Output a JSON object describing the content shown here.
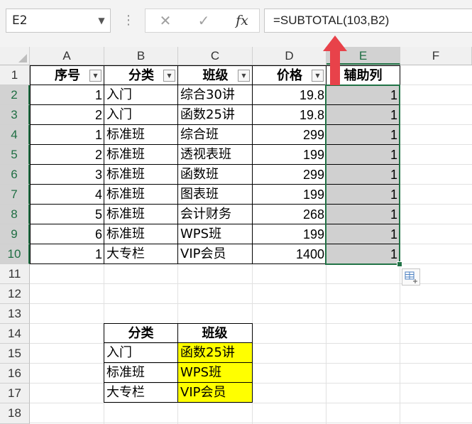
{
  "name_box": "E2",
  "formula_bar": {
    "formula": "=SUBTOTAL(103,B2)",
    "cancel_glyph": "✕",
    "enter_glyph": "✓",
    "fx_glyph": "fx",
    "dots": "⋮"
  },
  "columns": [
    "A",
    "B",
    "C",
    "D",
    "E",
    "F"
  ],
  "rows": [
    "1",
    "2",
    "3",
    "4",
    "5",
    "6",
    "7",
    "8",
    "9",
    "10",
    "11",
    "12",
    "13",
    "14",
    "15",
    "16",
    "17",
    "18"
  ],
  "table": {
    "headers": [
      "序号",
      "分类",
      "班级",
      "价格",
      "辅助列"
    ],
    "rows": [
      [
        "1",
        "入门",
        "综合30讲",
        "19.8",
        "1"
      ],
      [
        "2",
        "入门",
        "函数25讲",
        "19.8",
        "1"
      ],
      [
        "1",
        "标准班",
        "综合班",
        "299",
        "1"
      ],
      [
        "2",
        "标准班",
        "透视表班",
        "199",
        "1"
      ],
      [
        "3",
        "标准班",
        "函数班",
        "299",
        "1"
      ],
      [
        "4",
        "标准班",
        "图表班",
        "199",
        "1"
      ],
      [
        "5",
        "标准班",
        "会计财务",
        "268",
        "1"
      ],
      [
        "6",
        "标准班",
        "WPS班",
        "199",
        "1"
      ],
      [
        "1",
        "大专栏",
        "VIP会员",
        "1400",
        "1"
      ]
    ]
  },
  "lookup": {
    "headers": [
      "分类",
      "班级"
    ],
    "rows": [
      [
        "入门",
        "函数25讲"
      ],
      [
        "标准班",
        "WPS班"
      ],
      [
        "大专栏",
        "VIP会员"
      ]
    ]
  },
  "colors": {
    "highlight": "#ffff00",
    "shade": "#d0d0d0",
    "selection": "#217346",
    "arrow": "#e8424a"
  },
  "icons": {
    "filter": "dropdown-filter-icon",
    "quick_analysis": "quick-analysis-icon",
    "arrow": "red-up-arrow"
  }
}
